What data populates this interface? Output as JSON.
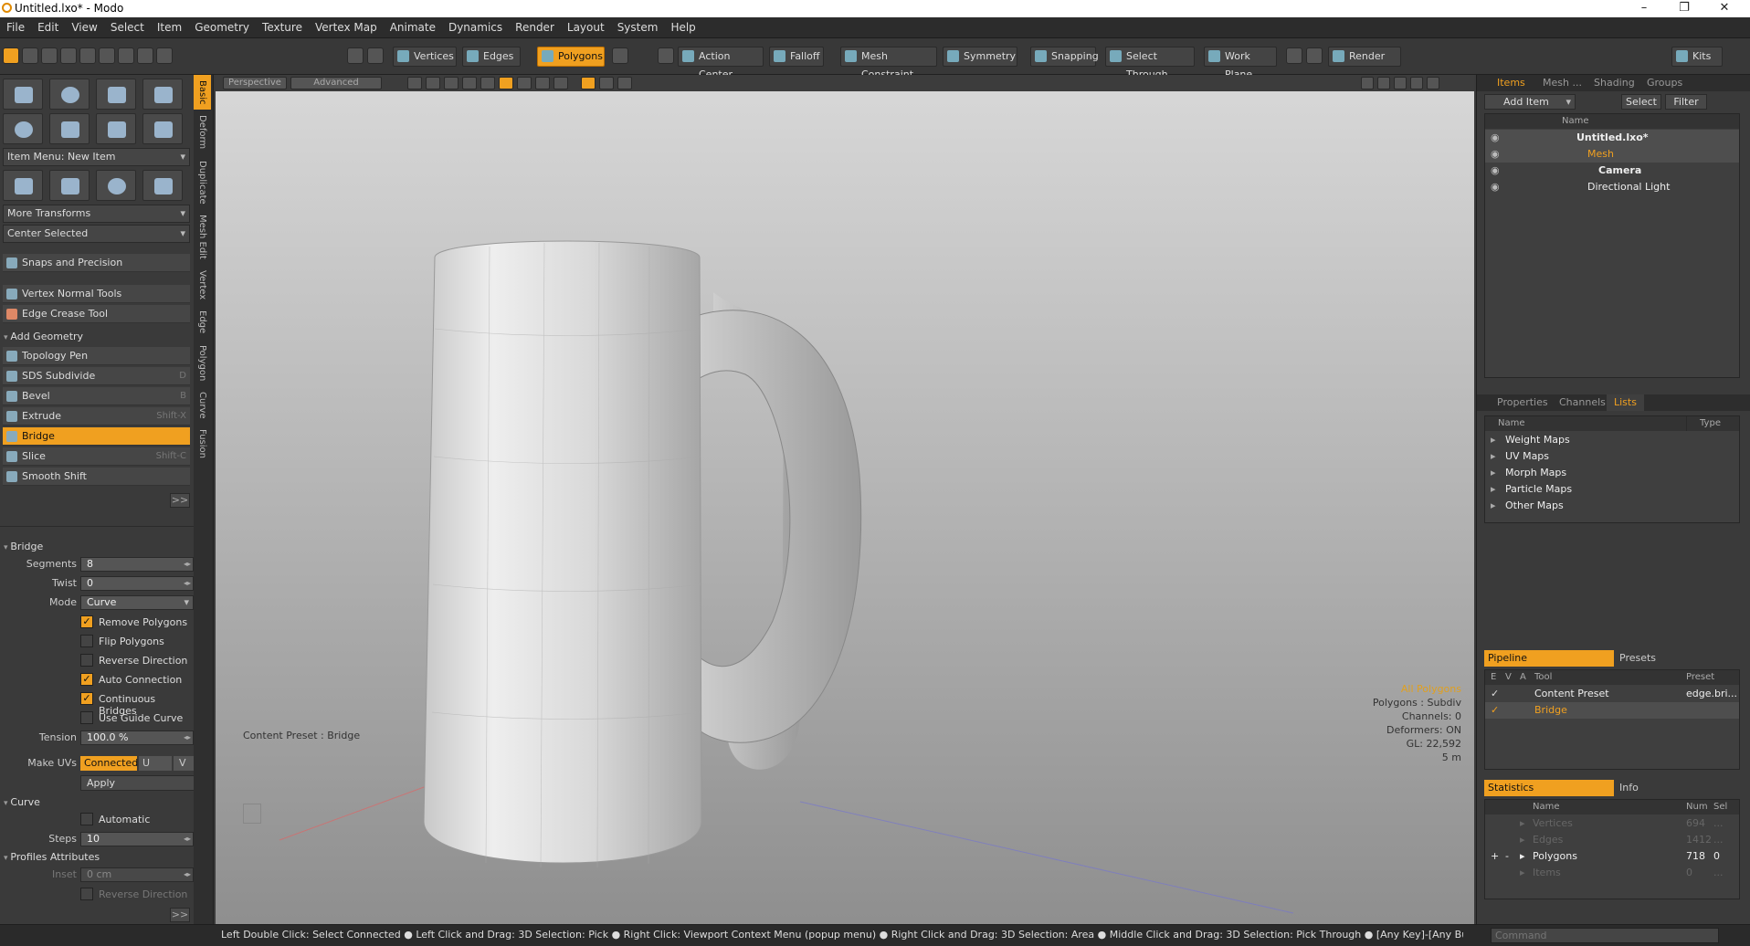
{
  "window": {
    "title": "Untitled.lxo* - Modo"
  },
  "menu": [
    "File",
    "Edit",
    "View",
    "Select",
    "Item",
    "Geometry",
    "Texture",
    "Vertex Map",
    "Animate",
    "Dynamics",
    "Render",
    "Layout",
    "System",
    "Help"
  ],
  "toolbar": {
    "vertices": "Vertices",
    "edges": "Edges",
    "polygons": "Polygons",
    "action_center": "Action Center",
    "falloff": "Falloff",
    "mesh_constraint": "Mesh Constraint",
    "symmetry": "Symmetry",
    "snapping": "Snapping",
    "select_through": "Select Through",
    "work_plane": "Work Plane",
    "render": "Render",
    "kits": "Kits"
  },
  "vtabs": [
    "Basic",
    "Deform",
    "Duplicate",
    "Mesh Edit",
    "Vertex",
    "Edge",
    "Polygon",
    "Curve",
    "Fusion"
  ],
  "left": {
    "item_menu": "Item Menu: New Item",
    "more_transforms": "More Transforms",
    "center_selected": "Center Selected",
    "snaps": "Snaps and Precision",
    "vertex_normal": "Vertex Normal Tools",
    "edge_crease": "Edge Crease Tool",
    "add_geometry": "Add Geometry",
    "tools": [
      {
        "label": "Topology Pen",
        "shortcut": ""
      },
      {
        "label": "SDS Subdivide",
        "shortcut": "D"
      },
      {
        "label": "Bevel",
        "shortcut": "B"
      },
      {
        "label": "Extrude",
        "shortcut": "Shift-X"
      },
      {
        "label": "Bridge",
        "shortcut": ""
      },
      {
        "label": "Slice",
        "shortcut": "Shift-C"
      },
      {
        "label": "Smooth Shift",
        "shortcut": ""
      }
    ],
    "more": ">>"
  },
  "props": {
    "section": "Bridge",
    "segments_label": "Segments",
    "segments": "8",
    "twist_label": "Twist",
    "twist": "0",
    "mode_label": "Mode",
    "mode": "Curve",
    "remove_polygons": "Remove Polygons",
    "flip_polygons": "Flip Polygons",
    "reverse_direction": "Reverse Direction",
    "auto_connection": "Auto Connection",
    "continuous_bridges": "Continuous Bridges",
    "use_guide_curve": "Use Guide Curve",
    "tension_label": "Tension",
    "tension": "100.0 %",
    "make_uvs_label": "Make UVs",
    "make_uvs": "Connected",
    "u": "U",
    "v": "V",
    "apply": "Apply",
    "curve_section": "Curve",
    "automatic": "Automatic",
    "steps_label": "Steps",
    "steps": "10",
    "profiles_section": "Profiles Attributes",
    "inset_label": "Inset",
    "inset": "0 cm",
    "reverse_direction2": "Reverse Direction",
    "more": ">>"
  },
  "viewport": {
    "view": "Perspective",
    "advanced": "Advanced",
    "content_preset": "Content Preset : Bridge",
    "info": [
      "All Polygons",
      "Polygons : Subdiv",
      "Channels: 0",
      "Deformers: ON",
      "GL: 22,592",
      "5 m"
    ]
  },
  "items_panel": {
    "tabs": [
      "Items",
      "Mesh ...",
      "Shading",
      "Groups"
    ],
    "add_item": "Add Item",
    "select": "Select",
    "filter": "Filter",
    "name_header": "Name",
    "rows": [
      "Untitled.lxo*",
      "Mesh",
      "Camera",
      "Directional Light"
    ]
  },
  "props_panel": {
    "tabs": [
      "Properties",
      "Channels",
      "Lists"
    ],
    "name_header": "Name",
    "type_header": "Type",
    "rows": [
      "Weight Maps",
      "UV Maps",
      "Morph Maps",
      "Particle Maps",
      "Other Maps"
    ]
  },
  "pipeline": {
    "tab": "Pipeline",
    "presets": "Presets",
    "headers": {
      "e": "E",
      "v": "V",
      "a": "A",
      "tool": "Tool",
      "preset": "Preset"
    },
    "rows": [
      {
        "tool": "Content Preset",
        "preset": "edge.bri..."
      },
      {
        "tool": "Bridge",
        "preset": ""
      }
    ]
  },
  "stats": {
    "tab": "Statistics",
    "info": "Info",
    "headers": {
      "name": "Name",
      "num": "Num",
      "sel": "Sel"
    },
    "rows": [
      {
        "name": "Vertices",
        "num": "694",
        "sel": "..."
      },
      {
        "name": "Edges",
        "num": "1412",
        "sel": "..."
      },
      {
        "name": "Polygons",
        "num": "718",
        "sel": "0"
      },
      {
        "name": "Items",
        "num": "0",
        "sel": "..."
      }
    ]
  },
  "status": "Left Double Click: Select Connected ● Left Click and Drag: 3D Selection: Pick ● Right Click: Viewport Context Menu (popup menu) ● Right Click and Drag: 3D Selection: Area ● Middle Click and Drag: 3D Selection: Pick Through ● [Any Key]-[Any Button] Click and Drag: dragDropB ...",
  "command_placeholder": "Command",
  "colors": {
    "accent": "#f0a020"
  }
}
